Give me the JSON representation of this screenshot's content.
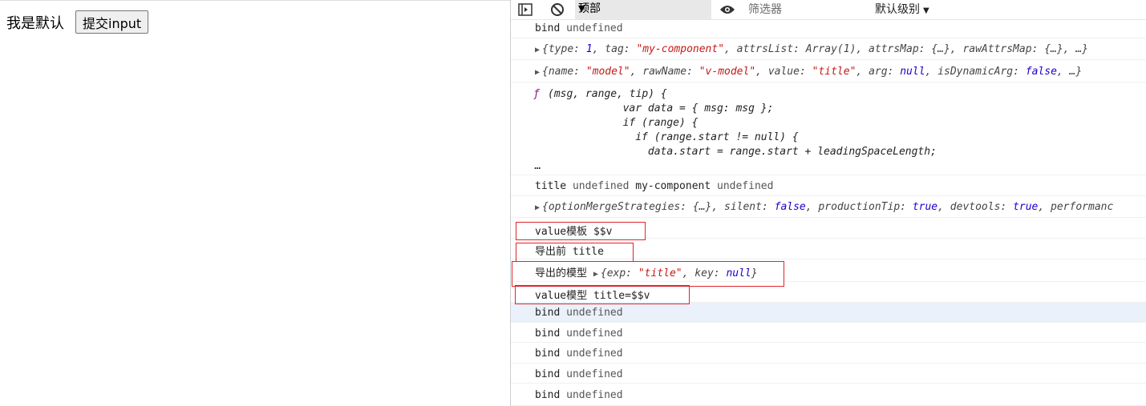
{
  "page": {
    "text": "我是默认",
    "button_label": "提交input"
  },
  "devtools": {
    "toolbar": {
      "context": "顶部",
      "filter_placeholder": "筛选器",
      "level": "默认级别"
    },
    "console": {
      "row1": {
        "k": "bind",
        "v": "undefined"
      },
      "row2": {
        "p1": "{type: ",
        "n1": "1",
        "p2": ", tag: ",
        "s1": "\"my-component\"",
        "p3": ", attrsList: Array(1), attrsMap: {…}, rawAttrsMap: {…}, …}"
      },
      "row3": {
        "p1": "{name: ",
        "s1": "\"model\"",
        "p2": ", rawName: ",
        "s2": "\"v-model\"",
        "p3": ", value: ",
        "s3": "\"title\"",
        "p4": ", arg: ",
        "n1": "null",
        "p5": ", isDynamicArg: ",
        "n2": "false",
        "p6": ", …}"
      },
      "fn_lines": [
        "(msg, range, tip) {",
        "              var data = { msg: msg };",
        "              if (range) {",
        "                if (range.start != null) {",
        "                  data.start = range.start + leadingSpaceLength;",
        "…"
      ],
      "fn_prefix": "ƒ",
      "row5": {
        "a": "title",
        "b": "undefined",
        "c": "my-component",
        "d": "undefined"
      },
      "row6": {
        "p1": "{optionMergeStrategies: {…}, silent: ",
        "n1": "false",
        "p2": ", productionTip: ",
        "n2": "true",
        "p3": ", devtools: ",
        "n3": "true",
        "p4": ", performanc"
      },
      "row7": "value模板 $$v",
      "row8": "导出前 title",
      "row9": {
        "label": "导出的模型",
        "p1": "{exp: ",
        "s1": "\"title\"",
        "p2": ", key: ",
        "n1": "null",
        "p3": "}"
      },
      "row10": "value模型 title=$$v",
      "bind_rows": [
        {
          "k": "bind",
          "v": "undefined"
        },
        {
          "k": "bind",
          "v": "undefined"
        },
        {
          "k": "bind",
          "v": "undefined"
        },
        {
          "k": "bind",
          "v": "undefined"
        },
        {
          "k": "bind",
          "v": "undefined"
        }
      ]
    }
  },
  "colors": {
    "highlight_box": "#e0242b",
    "selected_row": "#eaf1fb"
  },
  "icons": [
    "sidebar-toggle-icon",
    "clear-console-icon",
    "eye-icon",
    "dropdown-arrow-icon"
  ]
}
